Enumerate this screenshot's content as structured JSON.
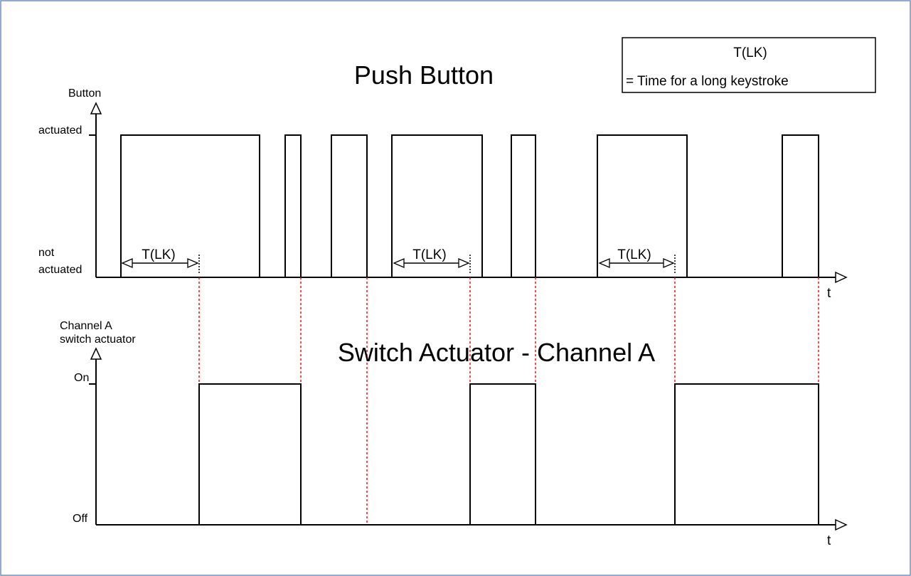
{
  "push_button": {
    "title": "Push Button",
    "y_axis_label": "Button",
    "high_label": "actuated",
    "low_label_line1": "not",
    "low_label_line2": "actuated",
    "x_axis_label": "t"
  },
  "switch_actuator": {
    "title": "Switch Actuator - Channel A",
    "y_axis_label_line1": "Channel A",
    "y_axis_label_line2": "switch actuator",
    "high_label": "On",
    "low_label": "Off",
    "x_axis_label": "t"
  },
  "legend": {
    "line1": "T(LK)",
    "line2": "= Time for a long keystroke"
  },
  "dimension_label": "T(LK)",
  "colors": {
    "frame_border": "#6d8fc4",
    "guide_lines": "#e01818",
    "signal": "#000000"
  }
}
